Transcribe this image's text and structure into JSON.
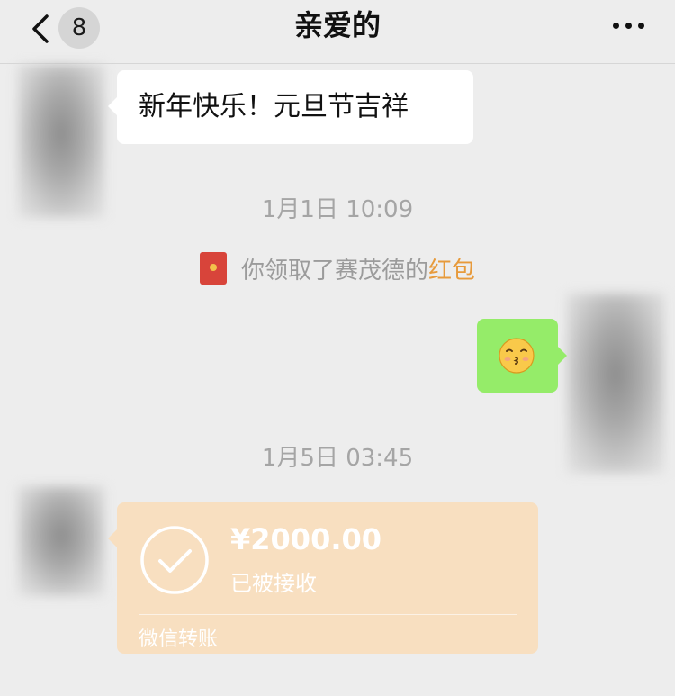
{
  "header": {
    "title": "亲爱的",
    "unread_count": "8"
  },
  "messages": {
    "greeting": "新年快乐！元旦节吉祥",
    "time_1": "1月1日 10:09",
    "system_prefix": "你领取了赛茂德的",
    "system_link": "红包",
    "emoji_name": "kissing-face-emoji",
    "time_2": "1月5日 03:45"
  },
  "transfer": {
    "amount": "¥2000.00",
    "status": "已被接收",
    "label": "微信转账"
  },
  "colors": {
    "background": "#ededed",
    "sent_bubble": "#95ec69",
    "transfer_card": "#f8dfc0",
    "link": "#e79a3b"
  }
}
